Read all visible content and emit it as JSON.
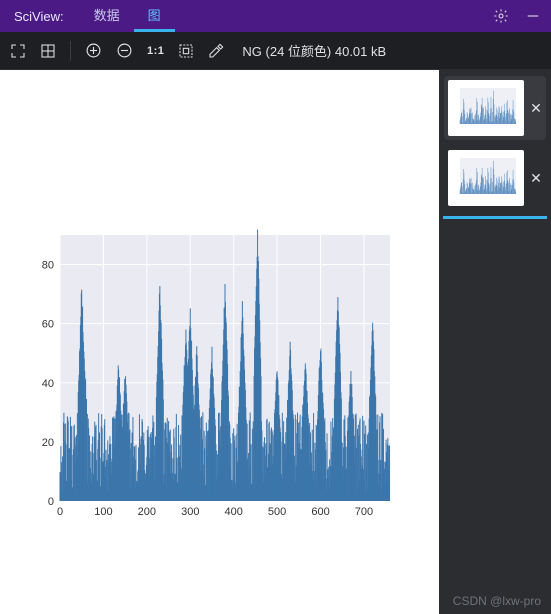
{
  "title": "SciView:",
  "tabs": {
    "data": "数据",
    "plot": "图"
  },
  "toolbar": {
    "one_to_one": "1:1"
  },
  "status": "NG (24 位颜色) 40.01 kB",
  "watermark": "CSDN @lxw-pro",
  "chart_data": {
    "type": "bar",
    "xlim": [
      0,
      760
    ],
    "ylim": [
      0,
      90
    ],
    "xticks": [
      0,
      100,
      200,
      300,
      400,
      500,
      600,
      700
    ],
    "yticks": [
      0,
      20,
      40,
      60,
      80
    ],
    "n": 760,
    "peaks": [
      [
        50,
        70
      ],
      [
        55,
        50
      ],
      [
        135,
        44
      ],
      [
        150,
        40
      ],
      [
        230,
        70
      ],
      [
        290,
        56
      ],
      [
        300,
        62
      ],
      [
        315,
        48
      ],
      [
        350,
        48
      ],
      [
        380,
        70
      ],
      [
        420,
        64
      ],
      [
        455,
        88
      ],
      [
        500,
        42
      ],
      [
        530,
        50
      ],
      [
        565,
        46
      ],
      [
        600,
        50
      ],
      [
        640,
        68
      ],
      [
        670,
        40
      ],
      [
        720,
        58
      ]
    ],
    "base_low": 3,
    "base_high": 30
  }
}
